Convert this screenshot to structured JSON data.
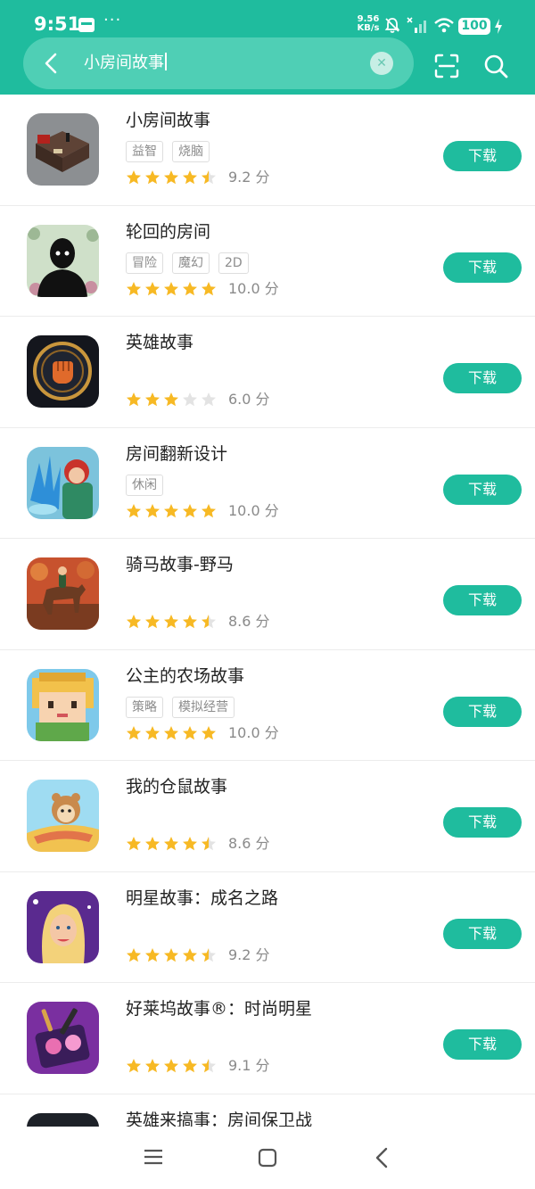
{
  "status_bar": {
    "time": "9:51",
    "dots": "···",
    "net_speed_value": "9.56",
    "net_speed_unit": "KB/s",
    "battery": "100"
  },
  "search": {
    "query": "小房间故事",
    "clear_icon": "close-icon",
    "back_icon": "chevron-left-icon",
    "scan_icon": "scan-icon",
    "search_icon": "search-icon"
  },
  "colors": {
    "accent": "#1fbc9e",
    "search_field": "#4fcfb5",
    "star": "#f7b924",
    "star_empty": "#e3e3e3"
  },
  "apps": [
    {
      "name": "小房间故事",
      "tags": [
        "益智",
        "烧脑"
      ],
      "stars": 4.5,
      "score": "9.2 分",
      "button": "下载"
    },
    {
      "name": "轮回的房间",
      "tags": [
        "冒险",
        "魔幻",
        "2D"
      ],
      "stars": 5,
      "score": "10.0 分",
      "button": "下载"
    },
    {
      "name": "英雄故事",
      "tags": [],
      "stars": 3,
      "score": "6.0 分",
      "button": "下载"
    },
    {
      "name": "房间翻新设计",
      "tags": [
        "休闲"
      ],
      "stars": 5,
      "score": "10.0 分",
      "button": "下载"
    },
    {
      "name": "骑马故事-野马",
      "tags": [],
      "stars": 4.5,
      "score": "8.6 分",
      "button": "下载"
    },
    {
      "name": "公主的农场故事",
      "tags": [
        "策略",
        "模拟经营"
      ],
      "stars": 5,
      "score": "10.0 分",
      "button": "下载"
    },
    {
      "name": "我的仓鼠故事",
      "tags": [],
      "stars": 4.5,
      "score": "8.6 分",
      "button": "下载"
    },
    {
      "name": "明星故事：成名之路",
      "tags": [],
      "stars": 4.5,
      "score": "9.2 分",
      "button": "下载"
    },
    {
      "name": "好莱坞故事®：时尚明星",
      "tags": [],
      "stars": 4.5,
      "score": "9.1 分",
      "button": "下载"
    },
    {
      "name": "英雄来搞事：房间保卫战",
      "tags": [],
      "stars": 0,
      "score": "",
      "button": ""
    }
  ],
  "nav": {
    "menu_icon": "menu-icon",
    "home_icon": "home-square-icon",
    "back_icon": "back-triangle-icon"
  }
}
